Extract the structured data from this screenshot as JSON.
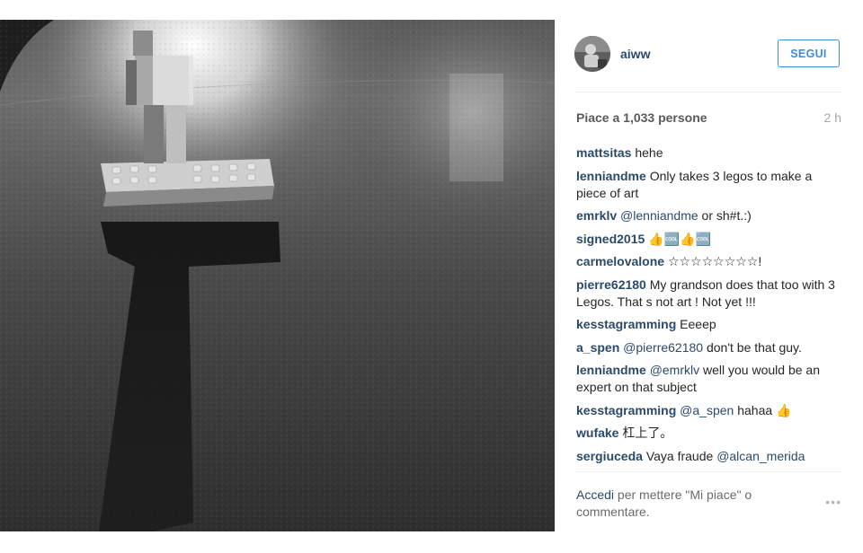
{
  "post": {
    "username": "aiww",
    "follow_label": "SEGUI",
    "likes_text": "Piace a 1,033 persone",
    "time_ago": "2 h"
  },
  "comments": [
    {
      "user": "mattsitas",
      "text": "hehe"
    },
    {
      "user": "lenniandme",
      "text": "Only takes 3 legos to make a piece of art"
    },
    {
      "user": "emrklv",
      "mention": "@lenniandme",
      "text": "or sh#t.:)"
    },
    {
      "user": "signed2015",
      "text": "👍🆒👍🆒"
    },
    {
      "user": "carmelovalone",
      "text": "☆☆☆☆☆☆☆☆!"
    },
    {
      "user": "pierre62180",
      "text": "My grandson does that too with 3 Legos. That s not art ! Not yet !!!"
    },
    {
      "user": "kesstagramming",
      "text": "Eeeep"
    },
    {
      "user": "a_spen",
      "mention": "@pierre62180",
      "text": "don't be that guy."
    },
    {
      "user": "lenniandme",
      "mention": "@emrklv",
      "text": "well you would be an expert on that subject"
    },
    {
      "user": "kesstagramming",
      "mention": "@a_spen",
      "text": "hahaa 👍"
    },
    {
      "user": "wufake",
      "text": "杠上了。"
    },
    {
      "user": "sergiuceda",
      "text": "Vaya fraude",
      "mention_after": "@alcan_merida"
    }
  ],
  "footer": {
    "login_link": "Accedi",
    "login_text": "per mettere \"Mi piace\" o commentare.",
    "more_icon": "•••"
  },
  "icons": {
    "avatar": "user-avatar",
    "more": "more-options-icon"
  }
}
